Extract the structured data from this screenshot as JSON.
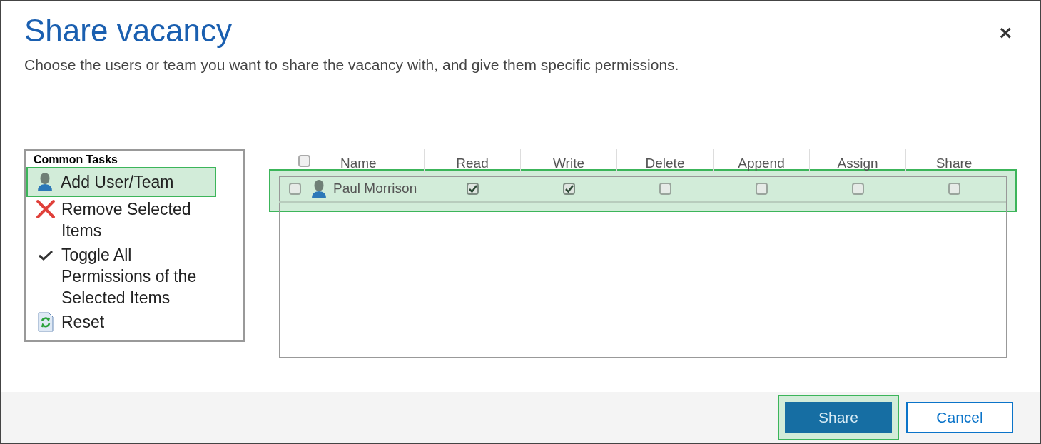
{
  "dialog": {
    "title": "Share vacancy",
    "subtitle": "Choose the users or team you want to share the vacancy with, and give them specific permissions.",
    "close": "×"
  },
  "tasks": {
    "heading": "Common Tasks",
    "items": [
      {
        "kind": "add",
        "label": "Add User/Team",
        "highlighted": true
      },
      {
        "kind": "remove",
        "label": "Remove Selected Items",
        "highlighted": false
      },
      {
        "kind": "toggle",
        "label": "Toggle All Permissions of the Selected Items",
        "highlighted": false
      },
      {
        "kind": "reset",
        "label": "Reset",
        "highlighted": false
      }
    ]
  },
  "grid": {
    "select_all": {
      "checked": false
    },
    "columns": [
      "Name",
      "Read",
      "Write",
      "Delete",
      "Append",
      "Assign",
      "Share"
    ],
    "rows": [
      {
        "name": "Paul Morrison",
        "checked": false,
        "highlighted": true,
        "permissions": [
          {
            "checked": true
          },
          {
            "checked": true
          },
          {
            "checked": false
          },
          {
            "checked": false
          },
          {
            "checked": false
          },
          {
            "checked": false
          }
        ]
      }
    ]
  },
  "buttons": [
    {
      "label": "Share",
      "kind": "primary",
      "highlighted": true
    },
    {
      "label": "Cancel",
      "kind": "secondary",
      "highlighted": false
    }
  ]
}
